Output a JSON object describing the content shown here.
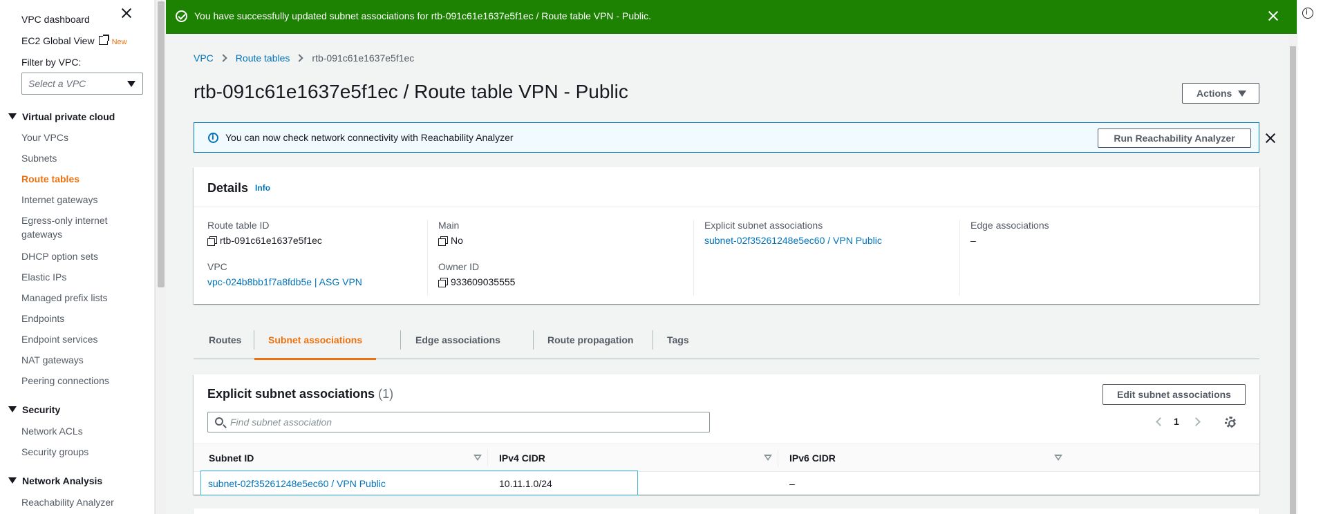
{
  "sidebar": {
    "top_items": [
      {
        "label": "VPC dashboard"
      },
      {
        "label": "EC2 Global View",
        "badge": "New"
      }
    ],
    "filter_label": "Filter by VPC:",
    "filter_placeholder": "Select a VPC",
    "sections": [
      {
        "title": "Virtual private cloud",
        "items": [
          {
            "label": "Your VPCs"
          },
          {
            "label": "Subnets"
          },
          {
            "label": "Route tables",
            "active": true
          },
          {
            "label": "Internet gateways"
          },
          {
            "label": "Egress-only internet gateways"
          },
          {
            "label": "DHCP option sets"
          },
          {
            "label": "Elastic IPs"
          },
          {
            "label": "Managed prefix lists"
          },
          {
            "label": "Endpoints"
          },
          {
            "label": "Endpoint services"
          },
          {
            "label": "NAT gateways"
          },
          {
            "label": "Peering connections"
          }
        ]
      },
      {
        "title": "Security",
        "items": [
          {
            "label": "Network ACLs"
          },
          {
            "label": "Security groups"
          }
        ]
      },
      {
        "title": "Network Analysis",
        "items": [
          {
            "label": "Reachability Analyzer"
          }
        ]
      }
    ]
  },
  "flash": {
    "message": "You have successfully updated subnet associations for rtb-091c61e1637e5f1ec / Route table VPN - Public.",
    "color": "#1d8102"
  },
  "breadcrumb": {
    "items": [
      "VPC",
      "Route tables"
    ],
    "current": "rtb-091c61e1637e5f1ec"
  },
  "page": {
    "title": "rtb-091c61e1637e5f1ec / Route table VPN - Public",
    "actions_label": "Actions"
  },
  "info_banner": {
    "text": "You can now check network connectivity with Reachability Analyzer",
    "button_label": "Run Reachability Analyzer"
  },
  "details": {
    "title": "Details",
    "info": "Info",
    "route_table_id_label": "Route table ID",
    "route_table_id": "rtb-091c61e1637e5f1ec",
    "vpc_label": "VPC",
    "vpc": "vpc-024b8bb1f7a8fdb5e | ASG VPN",
    "main_label": "Main",
    "main": "No",
    "owner_label": "Owner ID",
    "owner": "933609035555",
    "explicit_label": "Explicit subnet associations",
    "explicit": "subnet-02f35261248e5ec60 / VPN Public",
    "edge_label": "Edge associations",
    "edge": "–"
  },
  "tabs": [
    {
      "label": "Routes"
    },
    {
      "label": "Subnet associations",
      "active": true
    },
    {
      "label": "Edge associations"
    },
    {
      "label": "Route propagation"
    },
    {
      "label": "Tags"
    }
  ],
  "assoc": {
    "title": "Explicit subnet associations",
    "count": "(1)",
    "edit_label": "Edit subnet associations",
    "search_placeholder": "Find subnet association",
    "page": "1",
    "columns": [
      "Subnet ID",
      "IPv4 CIDR",
      "IPv6 CIDR"
    ],
    "rows": [
      {
        "subnet": "subnet-02f35261248e5ec60 / VPN Public",
        "ipv4": "10.11.1.0/24",
        "ipv6": "–"
      }
    ]
  },
  "colors": {
    "accent": "#ec7211",
    "link": "#0073bb",
    "success": "#1d8102"
  }
}
